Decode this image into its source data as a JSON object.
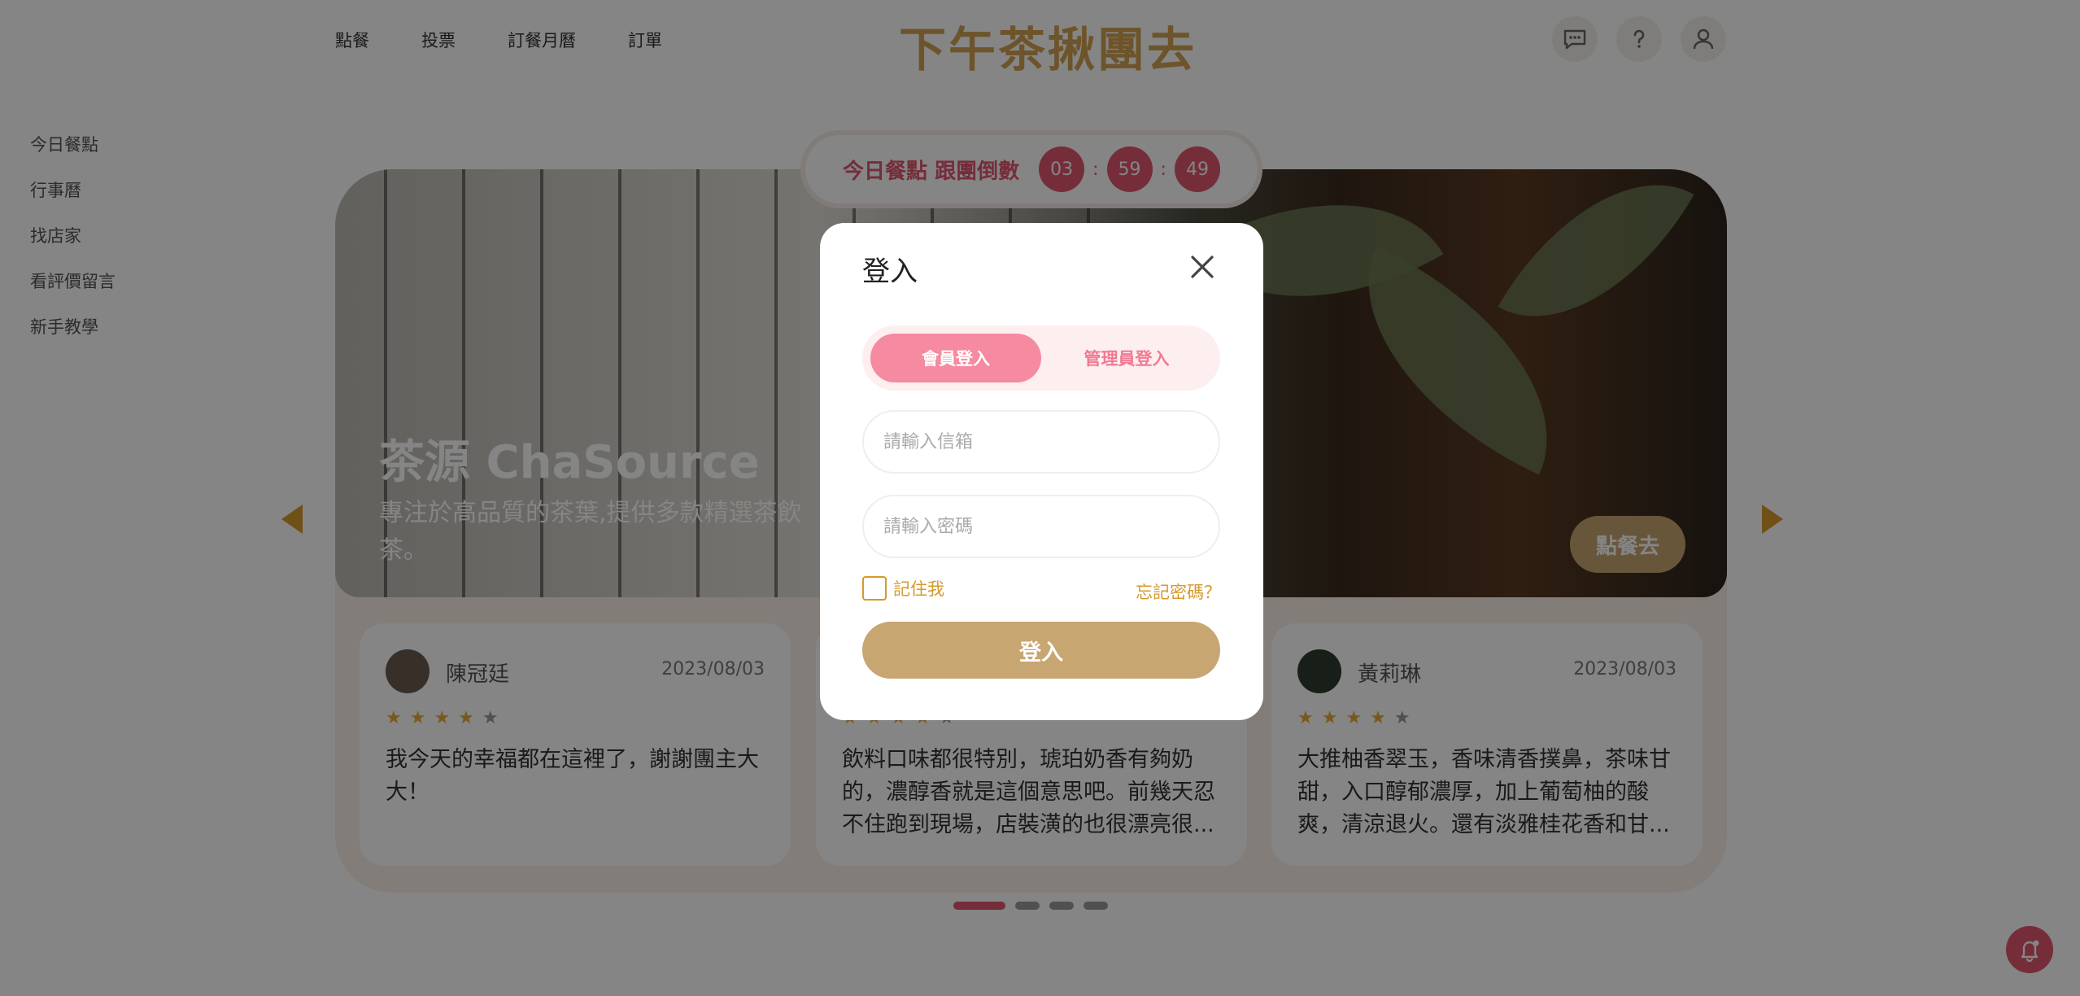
{
  "header": {
    "nav": [
      "點餐",
      "投票",
      "訂餐月曆",
      "訂單"
    ],
    "logo": "下午茶揪團去",
    "icons": [
      "chat-icon",
      "help-icon",
      "user-icon"
    ]
  },
  "sidebar": {
    "items": [
      "今日餐點",
      "行事曆",
      "找店家",
      "看評價留言",
      "新手教學"
    ]
  },
  "countdown": {
    "label": "今日餐點 跟團倒數",
    "hours": "03",
    "minutes": "59",
    "seconds": "49",
    "separator": ":"
  },
  "hero": {
    "title": "茶源 ChaSource",
    "description": "專注於高品質的茶葉,提供多款精選茶飲",
    "description_tail": "茶。",
    "order_button": "點餐去"
  },
  "reviews": [
    {
      "name": "陳冠廷",
      "date": "2023/08/03",
      "rating": 4,
      "text": "我今天的幸福都在這裡了，謝謝團主大大！"
    },
    {
      "name": "",
      "date": "",
      "rating": 4,
      "text": "飲料口味都很特別，琥珀奶香有夠奶的，濃醇香就是這個意思吧。前幾天忍不住跑到現場，店裝潢的也很漂亮很..."
    },
    {
      "name": "黃莉琳",
      "date": "2023/08/03",
      "rating": 4,
      "text": "大推柚香翠玉，香味清香撲鼻，茶味甘甜，入口醇郁濃厚，加上葡萄柚的酸爽，清涼退火。還有淡雅桂花香和甘..."
    }
  ],
  "carousel": {
    "pages": 4,
    "active": 1
  },
  "modal": {
    "title": "登入",
    "tabs": [
      "會員登入",
      "管理員登入"
    ],
    "email_placeholder": "請輸入信箱",
    "password_placeholder": "請輸入密碼",
    "remember_label": "記住我",
    "forgot_label": "忘記密碼？",
    "submit_label": "登入"
  },
  "colors": {
    "brand_gold": "#c8a671",
    "logo_gold": "#d1a253",
    "accent_pink": "#e0566f",
    "tab_pink": "#f58aa0",
    "link_orange": "#d59a2b"
  }
}
